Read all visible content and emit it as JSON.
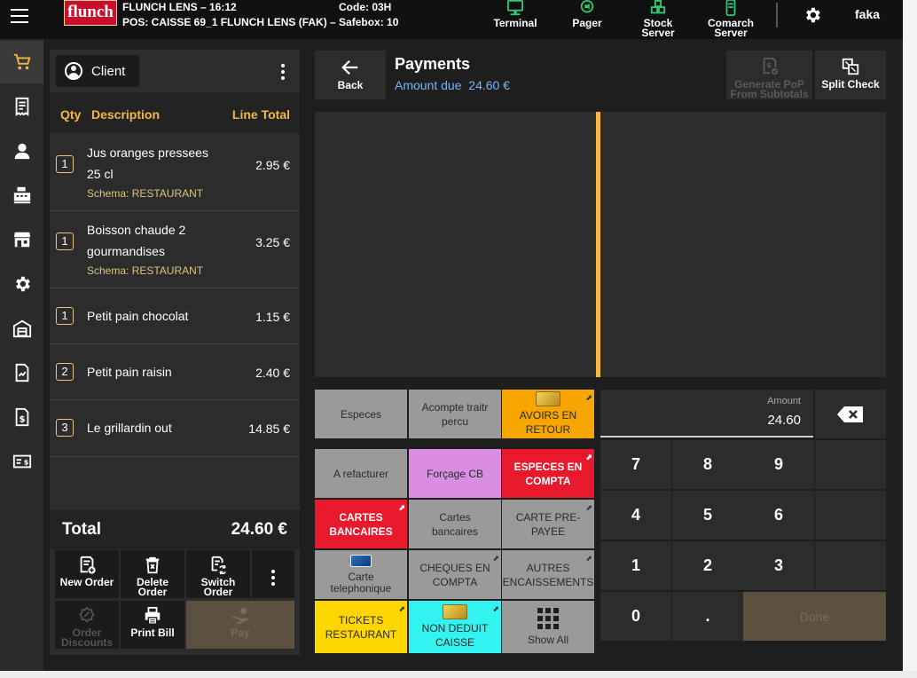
{
  "header": {
    "logo": "flunch",
    "line1": "FLUNCH LENS – 16:12",
    "code": "Code: 03H",
    "line2": "POS: CAISSE 69_1 FLUNCH LENS (FAK) – Safebox: 10",
    "buttons": [
      {
        "line1": "Terminal",
        "line2": "",
        "icon": "terminal-icon"
      },
      {
        "line1": "Pager",
        "line2": "",
        "icon": "pager-icon"
      },
      {
        "line1": "Stock",
        "line2": "Server",
        "icon": "stock-server-icon"
      },
      {
        "line1": "Comarch",
        "line2": "Server",
        "icon": "comarch-server-icon"
      }
    ],
    "user": "faka",
    "accent_green": "#2ecc71"
  },
  "sidebar": {
    "items": [
      "cart-icon",
      "receipt-icon",
      "person-icon",
      "cash-register-icon",
      "store-icon",
      "settings-icon",
      "warehouse-icon",
      "report-icon",
      "money-document-icon",
      "payment-card-icon"
    ],
    "active": 0
  },
  "order": {
    "client_label": "Client",
    "columns": {
      "qty": "Qty",
      "description": "Description",
      "line_total": "Line Total"
    },
    "items": [
      {
        "qty": "1",
        "line1": "Jus oranges pressees",
        "line2": "25 cl",
        "schema": "Schema: RESTAURANT",
        "price": "2.95 €"
      },
      {
        "qty": "1",
        "line1": "Boisson chaude 2",
        "line2": "gourmandises",
        "schema": "Schema: RESTAURANT",
        "price": "3.25 €"
      },
      {
        "qty": "1",
        "line1": "Petit pain chocolat",
        "line2": "",
        "schema": "",
        "price": "1.15 €"
      },
      {
        "qty": "2",
        "line1": "Petit pain raisin",
        "line2": "",
        "schema": "",
        "price": "2.40 €"
      },
      {
        "qty": "3",
        "line1": "Le grillardin out",
        "line2": "",
        "schema": "",
        "price": "14.85 €"
      }
    ],
    "total_label": "Total",
    "total_value": "24.60 €",
    "actions": [
      {
        "line1": "New Order",
        "line2": ""
      },
      {
        "line1": "Delete",
        "line2": "Order"
      },
      {
        "line1": "Switch",
        "line2": "Order"
      },
      {
        "line1": "Order",
        "line2": "Discounts"
      },
      {
        "line1": "Print Bill",
        "line2": ""
      },
      {
        "line1": "Pay",
        "line2": ""
      }
    ]
  },
  "payments": {
    "back_label": "Back",
    "title": "Payments",
    "amount_due_label": "Amount due",
    "amount_due_value": "24.60 €",
    "generate_pop": {
      "line1": "Generate PoP",
      "line2": "From Subtotals"
    },
    "split_check": "Split Check",
    "split_color": "#f5b646",
    "tenders": [
      {
        "line1": "Especes",
        "line2": "",
        "color": "#9a9a9a",
        "icon": "",
        "ext": false
      },
      {
        "line1": "Acompte traitr",
        "line2": "percu",
        "color": "#9a9a9a",
        "icon": "",
        "ext": false
      },
      {
        "line1": "AVOIRS EN",
        "line2": "RETOUR",
        "color": "#f7a600",
        "icon": "gift-card-icon",
        "ext": true
      },
      {
        "line1": "A refacturer",
        "line2": "",
        "color": "#9a9a9a",
        "icon": "",
        "ext": false
      },
      {
        "line1": "Forçage CB",
        "line2": "",
        "color": "#d98ee3",
        "icon": "",
        "ext": false
      },
      {
        "line1": "ESPECES EN",
        "line2": "COMPTA",
        "color": "#e8192c",
        "icon": "",
        "ext": true
      },
      {
        "line1": "CARTES",
        "line2": "BANCAIRES",
        "color": "#e8192c",
        "icon": "",
        "ext": true
      },
      {
        "line1": "Cartes",
        "line2": "bancaires",
        "color": "#9a9a9a",
        "icon": "",
        "ext": false
      },
      {
        "line1": "CARTE PRE-",
        "line2": "PAYEE",
        "color": "#9a9a9a",
        "icon": "",
        "ext": true
      },
      {
        "line1": "Carte",
        "line2": "telephonique",
        "color": "#9a9a9a",
        "icon": "phone-card-icon",
        "ext": false
      },
      {
        "line1": "CHEQUES EN",
        "line2": "COMPTA",
        "color": "#9a9a9a",
        "icon": "",
        "ext": true
      },
      {
        "line1": "AUTRES",
        "line2": "ENCAISSEMENTS",
        "color": "#9a9a9a",
        "icon": "",
        "ext": true
      },
      {
        "line1": "TICKETS",
        "line2": "RESTAURANT",
        "color": "#ffd600",
        "icon": "",
        "ext": true
      },
      {
        "line1": "NON DEDUIT",
        "line2": "CAISSE",
        "color": "#33f3f0",
        "icon": "gift-card-icon",
        "ext": true
      },
      {
        "line1": "Show All",
        "line2": "",
        "color": "#9a9a9a",
        "icon": "grid-icon",
        "ext": false
      }
    ],
    "keypad": {
      "amount_label": "Amount",
      "amount_value": "24.60",
      "keys": [
        "7",
        "8",
        "9",
        "4",
        "5",
        "6",
        "1",
        "2",
        "3",
        "0",
        "."
      ],
      "done": "Done"
    }
  }
}
